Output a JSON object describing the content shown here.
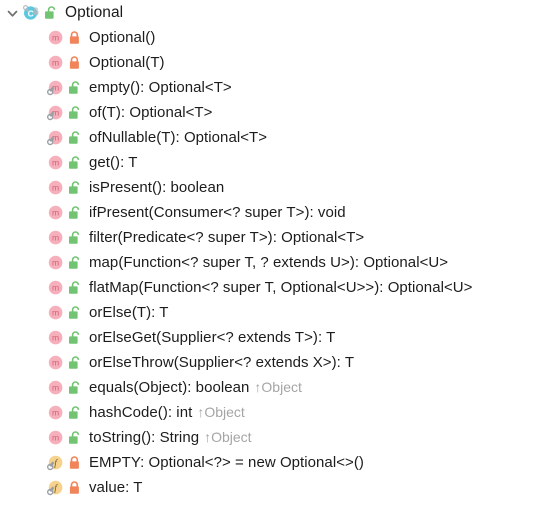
{
  "view": {
    "name": "structure-tree",
    "background": "#ffffff",
    "text_color": "#1c1c1c",
    "override_color": "#a5a5a5"
  },
  "colors": {
    "class_icon": "#5bc8e0",
    "method_icon": "#f5b0bb",
    "method_glyph": "#d9607a",
    "field_icon": "#f6d28c",
    "field_glyph": "#6b5a2a",
    "lock_private": "#f0845a",
    "lock_public": "#72c472",
    "static_overlay": "#9aa0a6",
    "chevron": "#6e6e6e"
  },
  "rows": [
    {
      "kind": "class",
      "icon": "class-icon",
      "lock": "unlock-green-icon",
      "static": false,
      "expanded": true,
      "depth": 0,
      "label": "Optional",
      "override": ""
    },
    {
      "kind": "method",
      "icon": "method-icon",
      "lock": "lock-orange-icon",
      "static": false,
      "depth": 1,
      "label": "Optional()",
      "override": ""
    },
    {
      "kind": "method",
      "icon": "method-icon",
      "lock": "lock-orange-icon",
      "static": false,
      "depth": 1,
      "label": "Optional(T)",
      "override": ""
    },
    {
      "kind": "method",
      "icon": "method-icon",
      "lock": "unlock-green-icon",
      "static": true,
      "depth": 1,
      "label": "empty(): Optional<T>",
      "override": ""
    },
    {
      "kind": "method",
      "icon": "method-icon",
      "lock": "unlock-green-icon",
      "static": true,
      "depth": 1,
      "label": "of(T): Optional<T>",
      "override": ""
    },
    {
      "kind": "method",
      "icon": "method-icon",
      "lock": "unlock-green-icon",
      "static": true,
      "depth": 1,
      "label": "ofNullable(T): Optional<T>",
      "override": ""
    },
    {
      "kind": "method",
      "icon": "method-icon",
      "lock": "unlock-green-icon",
      "static": false,
      "depth": 1,
      "label": "get(): T",
      "override": ""
    },
    {
      "kind": "method",
      "icon": "method-icon",
      "lock": "unlock-green-icon",
      "static": false,
      "depth": 1,
      "label": "isPresent(): boolean",
      "override": ""
    },
    {
      "kind": "method",
      "icon": "method-icon",
      "lock": "unlock-green-icon",
      "static": false,
      "depth": 1,
      "label": "ifPresent(Consumer<? super T>): void",
      "override": ""
    },
    {
      "kind": "method",
      "icon": "method-icon",
      "lock": "unlock-green-icon",
      "static": false,
      "depth": 1,
      "label": "filter(Predicate<? super T>): Optional<T>",
      "override": ""
    },
    {
      "kind": "method",
      "icon": "method-icon",
      "lock": "unlock-green-icon",
      "static": false,
      "depth": 1,
      "label": "map(Function<? super T, ? extends U>): Optional<U>",
      "override": ""
    },
    {
      "kind": "method",
      "icon": "method-icon",
      "lock": "unlock-green-icon",
      "static": false,
      "depth": 1,
      "label": "flatMap(Function<? super T, Optional<U>>): Optional<U>",
      "override": ""
    },
    {
      "kind": "method",
      "icon": "method-icon",
      "lock": "unlock-green-icon",
      "static": false,
      "depth": 1,
      "label": "orElse(T): T",
      "override": ""
    },
    {
      "kind": "method",
      "icon": "method-icon",
      "lock": "unlock-green-icon",
      "static": false,
      "depth": 1,
      "label": "orElseGet(Supplier<? extends T>): T",
      "override": ""
    },
    {
      "kind": "method",
      "icon": "method-icon",
      "lock": "unlock-green-icon",
      "static": false,
      "depth": 1,
      "label": "orElseThrow(Supplier<? extends X>): T",
      "override": ""
    },
    {
      "kind": "method",
      "icon": "method-icon",
      "lock": "unlock-green-icon",
      "static": false,
      "depth": 1,
      "label": "equals(Object): boolean",
      "override": "↑Object"
    },
    {
      "kind": "method",
      "icon": "method-icon",
      "lock": "unlock-green-icon",
      "static": false,
      "depth": 1,
      "label": "hashCode(): int",
      "override": "↑Object"
    },
    {
      "kind": "method",
      "icon": "method-icon",
      "lock": "unlock-green-icon",
      "static": false,
      "depth": 1,
      "label": "toString(): String",
      "override": "↑Object"
    },
    {
      "kind": "field",
      "icon": "field-icon",
      "lock": "lock-orange-icon",
      "static": true,
      "depth": 1,
      "label": "EMPTY: Optional<?> = new Optional<>()",
      "override": ""
    },
    {
      "kind": "field",
      "icon": "field-icon",
      "lock": "lock-orange-icon",
      "static": true,
      "depth": 1,
      "label": "value: T",
      "override": ""
    }
  ]
}
